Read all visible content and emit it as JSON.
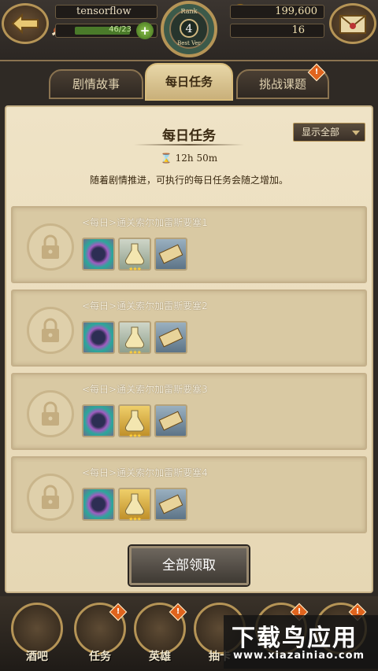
{
  "header": {
    "username": "tensorflow",
    "stamina": "46/23",
    "stamina_fraction": 1.0,
    "gold": "199,600",
    "gems": "16",
    "rank_label": "Rank",
    "rank_value": "4",
    "rank_sub": "Best Ver",
    "icons": {
      "back": "back-arrow-icon",
      "mail": "mail-icon",
      "stamina": "meat-icon",
      "gold": "coin-icon",
      "gems": "gem-icon",
      "add": "plus-icon"
    }
  },
  "tabs": [
    {
      "label": "剧情故事",
      "active": false,
      "badge": ""
    },
    {
      "label": "每日任务",
      "active": true,
      "badge": ""
    },
    {
      "label": "挑战课题",
      "active": false,
      "badge": "!"
    }
  ],
  "panel": {
    "title": "每日任务",
    "filter_label": "显示全部",
    "timer": "12h 50m",
    "description": "随着剧情推进，可执行的每日任务会随之增加。",
    "claim_all": "全部领取"
  },
  "quests": [
    {
      "name": "<每日>通关索尔加雷斯要塞1",
      "items": [
        "orb",
        "potion",
        "scroll"
      ]
    },
    {
      "name": "<每日>通关索尔加雷斯要塞2",
      "items": [
        "orb",
        "potion",
        "scroll"
      ]
    },
    {
      "name": "<每日>通关索尔加雷斯要塞3",
      "items": [
        "orb",
        "potion-gold",
        "scroll"
      ]
    },
    {
      "name": "<每日>通关索尔加雷斯要塞4",
      "items": [
        "orb",
        "potion-gold",
        "scroll"
      ]
    }
  ],
  "nav": [
    {
      "label": "酒吧",
      "badge": ""
    },
    {
      "label": "任务",
      "badge": "!"
    },
    {
      "label": "英雄",
      "badge": "!"
    },
    {
      "label": "抽卡",
      "badge": ""
    },
    {
      "label": "",
      "badge": "!"
    },
    {
      "label": "",
      "badge": "!"
    }
  ],
  "watermark": {
    "line1": "下载鸟应用",
    "line2": "www.xiazainiao.com"
  }
}
